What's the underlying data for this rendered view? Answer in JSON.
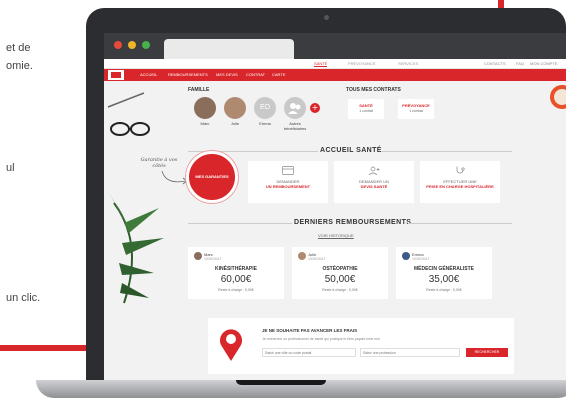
{
  "marketing": {
    "lines": [
      "et de",
      "omie.",
      "ul",
      "un clic."
    ]
  },
  "app": {
    "topnav": {
      "items": [
        {
          "label": "SANTÉ",
          "active": true
        },
        {
          "label": "PRÉVOYANCE",
          "active": false
        },
        {
          "label": "SERVICES",
          "active": false
        }
      ],
      "right_items": [
        "CONTACTS",
        "FAQ",
        "MON COMPTE"
      ]
    },
    "subnav": {
      "items": [
        "ACCUEIL",
        "REMBOURSEMENTS",
        "MES DEVIS",
        "CONTRAT",
        "CARTE"
      ]
    },
    "family": {
      "title": "FAMILLE",
      "members": [
        {
          "name": "Marc",
          "sub": "",
          "initials": "",
          "color": "#8a6d5a"
        },
        {
          "name": "Julie",
          "sub": "",
          "initials": "",
          "color": "#b08a70"
        },
        {
          "name": "Emma",
          "sub": "",
          "initials": "EO",
          "color": "#c9c9c9"
        },
        {
          "name": "Autres",
          "sub": "bénéficiaires",
          "initials": "",
          "color": "#c9c9c9"
        }
      ],
      "add_label": "+"
    },
    "contracts": {
      "title": "TOUS MES CONTRATS",
      "cards": [
        {
          "title": "SANTÉ",
          "sub": "1 contrat"
        },
        {
          "title": "PRÉVOYANCE",
          "sub": "1 contrat"
        }
      ]
    },
    "accueil": {
      "title": "ACCUEIL SANTÉ",
      "handwritten": "Garantie\nà vos côtés",
      "badge_text": "MES\nGARANTIES",
      "actions": [
        {
          "line1": "DEMANDER",
          "line2": "UN REMBOURSEMENT",
          "icon": "card-icon"
        },
        {
          "line1": "DEMANDER UN",
          "line2": "DEVIS SANTÉ",
          "icon": "add-user-icon"
        },
        {
          "line1": "EFFECTUER UNE",
          "line2": "PRISE EN CHARGE HOSPITALIÈRE",
          "icon": "stethoscope-icon"
        }
      ]
    },
    "reimbursements": {
      "title": "DERNIERS REMBOURSEMENTS",
      "history_link": "VOIR HISTORIQUE",
      "cards": [
        {
          "name": "Marc",
          "date": "10/02/2017",
          "category": "KINÉSITHÉRAPIE",
          "amount": "60,00€",
          "base": "Reste à charge : 0,00€"
        },
        {
          "name": "Julie",
          "date": "10/02/2017",
          "category": "OSTÉOPATHIE",
          "amount": "50,00€",
          "base": "Reste à charge : 0,00€"
        },
        {
          "name": "Emma",
          "date": "10/02/2017",
          "category": "MÉDECIN GÉNÉRALISTE",
          "amount": "35,00€",
          "base": "Reste à charge : 0,00€"
        }
      ]
    },
    "search": {
      "title": "JE NE SOUHAITE PAS AVANCER LES FRAIS",
      "desc": "Je recherche un professionnel de santé qui pratique le tiers payant near moi",
      "input1_placeholder": "Saisir une ville ou code postal",
      "input2_placeholder": "Saisir une profession",
      "button_label": "RECHERCHER"
    },
    "colors": {
      "accent": "#d9262a",
      "background": "#f2f2f2",
      "laptop": "#2b2d31"
    }
  }
}
